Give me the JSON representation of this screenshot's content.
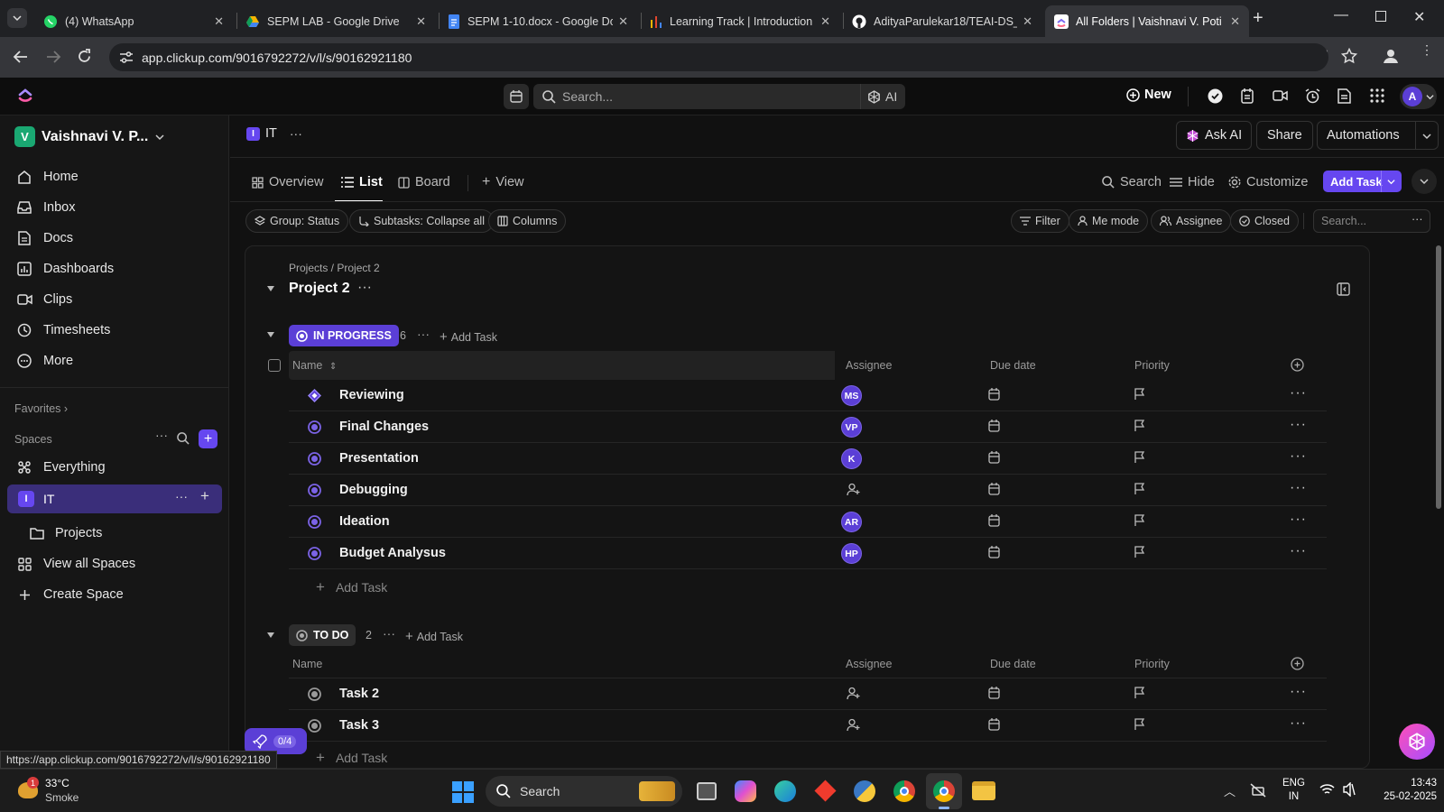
{
  "browser": {
    "tabs": [
      {
        "title": "(4) WhatsApp",
        "icon": "whatsapp-icon"
      },
      {
        "title": "SEPM LAB - Google Drive",
        "icon": "google-drive-icon"
      },
      {
        "title": "SEPM 1-10.docx - Google Do",
        "icon": "google-docs-icon"
      },
      {
        "title": "Learning Track | Introduction",
        "icon": "learning-track-icon"
      },
      {
        "title": "AdityaParulekar18/TEAI-DS_S",
        "icon": "github-icon"
      },
      {
        "title": "All Folders | Vaishnavi V. Poti",
        "icon": "clickup-icon"
      }
    ],
    "url": "app.clickup.com/9016792272/v/l/s/90162921180",
    "status_url": "https://app.clickup.com/9016792272/v/l/s/90162921180"
  },
  "topbar": {
    "search_placeholder": "Search...",
    "ai_label": "AI",
    "new_label": "New",
    "avatar_letter": "A"
  },
  "sidebar": {
    "workspace_initial": "V",
    "workspace_name": "Vaishnavi V. P...",
    "nav": [
      {
        "label": "Home",
        "icon": "home-icon"
      },
      {
        "label": "Inbox",
        "icon": "inbox-icon"
      },
      {
        "label": "Docs",
        "icon": "docs-icon"
      },
      {
        "label": "Dashboards",
        "icon": "dashboards-icon"
      },
      {
        "label": "Clips",
        "icon": "clips-icon"
      },
      {
        "label": "Timesheets",
        "icon": "timesheets-icon"
      },
      {
        "label": "More",
        "icon": "more-icon"
      }
    ],
    "favorites_label": "Favorites",
    "spaces_label": "Spaces",
    "everything_label": "Everything",
    "space_initial": "I",
    "space_name": "IT",
    "projects_label": "Projects",
    "view_all_spaces": "View all Spaces",
    "create_space": "Create Space",
    "onboarding_count": "0/4"
  },
  "header": {
    "space_initial": "I",
    "space_name": "IT",
    "ask_ai": "Ask AI",
    "share": "Share",
    "automations": "Automations"
  },
  "views": {
    "tabs": [
      "Overview",
      "List",
      "Board"
    ],
    "add_view": "View",
    "search": "Search",
    "hide": "Hide",
    "customize": "Customize",
    "add_task": "Add Task"
  },
  "toolbar": {
    "group": "Group: Status",
    "subtasks": "Subtasks: Collapse all",
    "columns": "Columns",
    "filter": "Filter",
    "me_mode": "Me mode",
    "assignee": "Assignee",
    "closed": "Closed",
    "search_placeholder": "Search..."
  },
  "list": {
    "breadcrumb": "Projects / Project 2",
    "title": "Project 2",
    "columns": {
      "name": "Name",
      "assignee": "Assignee",
      "due_date": "Due date",
      "priority": "Priority"
    },
    "add_task_label": "Add Task",
    "groups": [
      {
        "status": "IN PROGRESS",
        "count": "6",
        "color": "#5b3fd6",
        "tasks": [
          {
            "name": "Reviewing",
            "assignee": "MS"
          },
          {
            "name": "Final Changes",
            "assignee": "VP"
          },
          {
            "name": "Presentation",
            "assignee": "K"
          },
          {
            "name": "Debugging",
            "assignee": ""
          },
          {
            "name": "Ideation",
            "assignee": "AR"
          },
          {
            "name": "Budget Analysus",
            "assignee": "HP"
          }
        ]
      },
      {
        "status": "TO DO",
        "count": "2",
        "color": "#3a3a3a",
        "tasks": [
          {
            "name": "Task 2",
            "assignee": ""
          },
          {
            "name": "Task 3",
            "assignee": ""
          }
        ]
      }
    ]
  },
  "taskbar": {
    "weather_temp": "33°C",
    "weather_desc": "Smoke",
    "weather_badge": "1",
    "search": "Search",
    "lang1": "ENG",
    "lang2": "IN",
    "time": "13:43",
    "date": "25-02-2025"
  },
  "colors": {
    "accent": "#5b3fd6",
    "accent_button": "#6647f0"
  }
}
